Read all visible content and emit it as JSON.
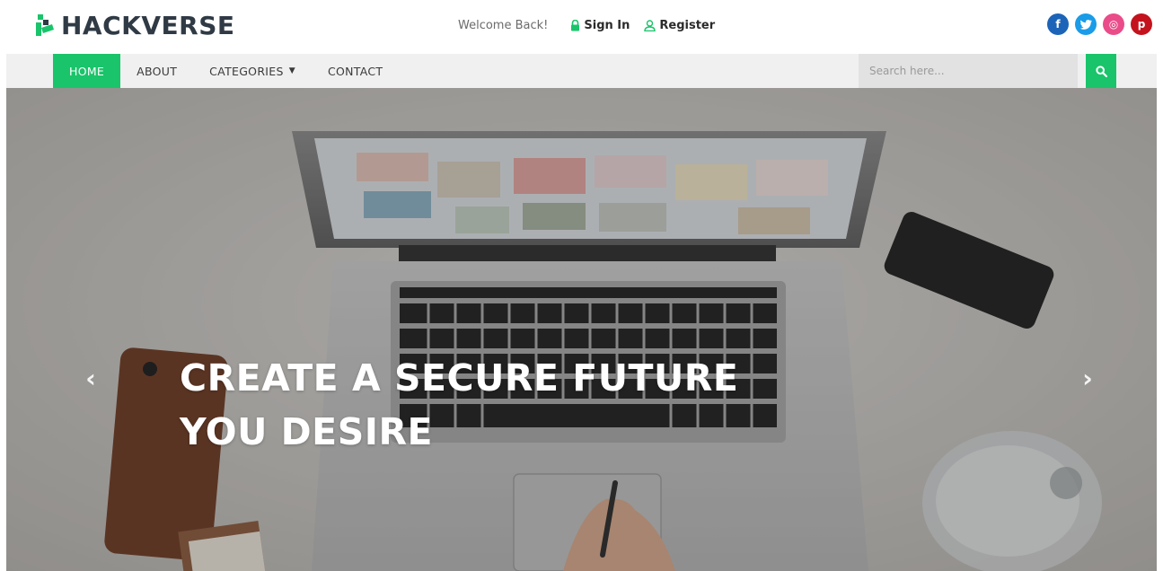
{
  "brand": {
    "name": "HACKVERSE",
    "accent": "#19c46a",
    "text_color": "#2f3a45"
  },
  "topbar": {
    "welcome": "Welcome Back!",
    "sign_in": {
      "label": "Sign In",
      "icon": "lock-icon"
    },
    "register": {
      "label": "Register",
      "icon": "user-icon"
    }
  },
  "socials": [
    {
      "name": "facebook",
      "glyph": "f",
      "color": "#1c64b8"
    },
    {
      "name": "twitter",
      "glyph": "t",
      "color": "#1a9ce8"
    },
    {
      "name": "dribbble",
      "glyph": "◎",
      "color": "#ea4c89"
    },
    {
      "name": "pinterest",
      "glyph": "p",
      "color": "#c4131d"
    }
  ],
  "nav": {
    "items": [
      {
        "label": "HOME",
        "active": true
      },
      {
        "label": "ABOUT",
        "active": false
      },
      {
        "label": "CATEGORIES",
        "active": false,
        "dropdown": true
      },
      {
        "label": "CONTACT",
        "active": false
      }
    ],
    "search_placeholder": "Search here...",
    "search_icon": "search-icon"
  },
  "hero": {
    "title_line1": "CREATE A SECURE FUTURE",
    "title_line2": "YOU DESIRE",
    "prev_icon": "chevron-left-icon",
    "next_icon": "chevron-right-icon"
  }
}
